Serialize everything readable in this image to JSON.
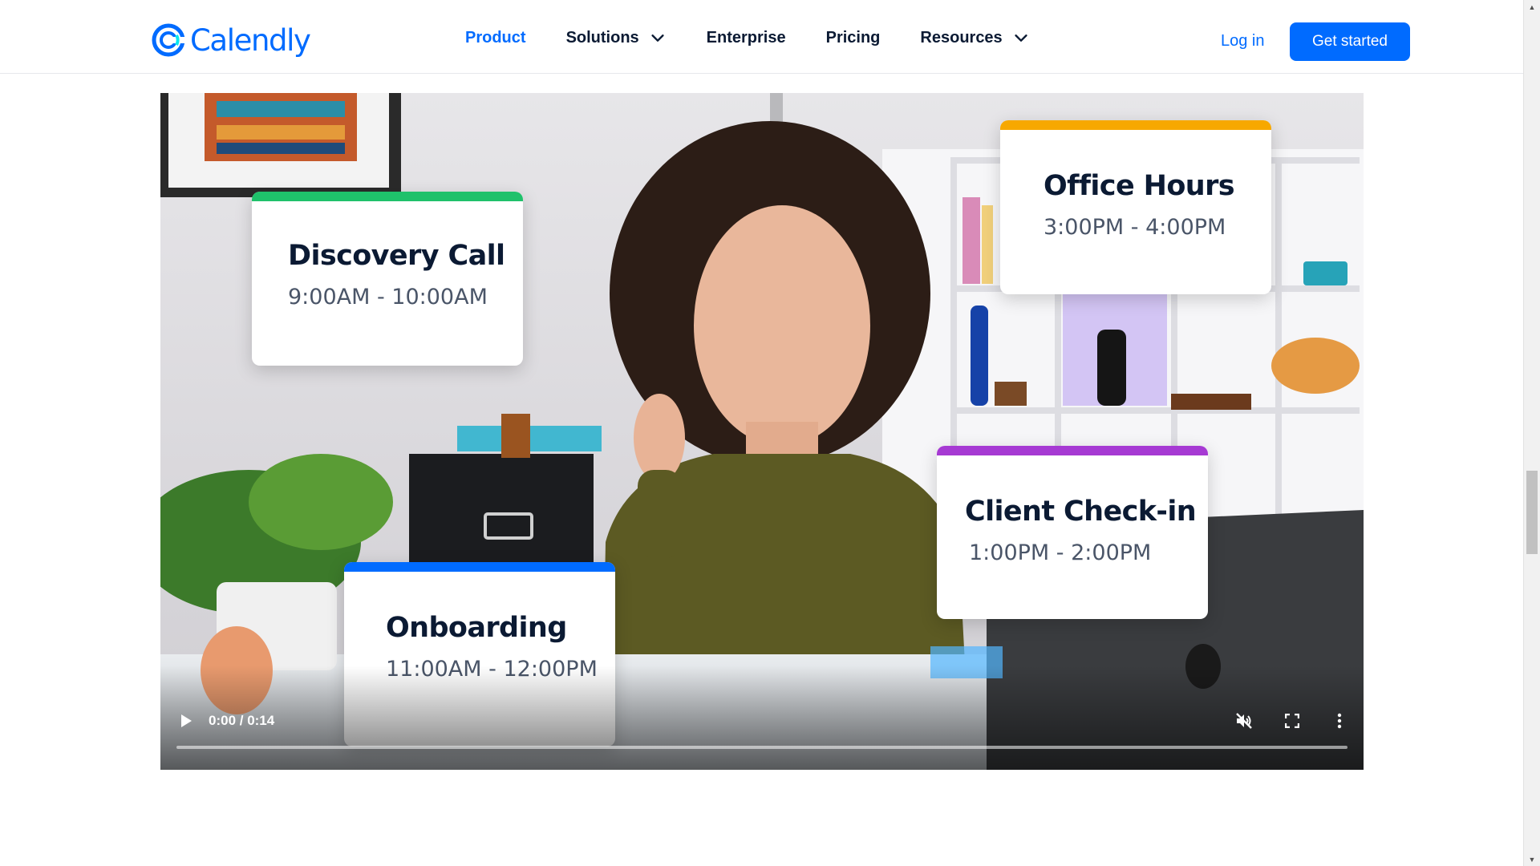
{
  "brand": {
    "name": "Calendly",
    "color": "#006bff"
  },
  "nav": {
    "items": [
      {
        "label": "Product",
        "active": true,
        "dropdown": false
      },
      {
        "label": "Solutions",
        "active": false,
        "dropdown": true
      },
      {
        "label": "Enterprise",
        "active": false,
        "dropdown": false
      },
      {
        "label": "Pricing",
        "active": false,
        "dropdown": false
      },
      {
        "label": "Resources",
        "active": false,
        "dropdown": true
      }
    ],
    "login_label": "Log in",
    "cta_label": "Get started"
  },
  "video": {
    "cards": [
      {
        "title": "Discovery Call",
        "time": "9:00AM - 10:00AM",
        "accent": "#1fc16b"
      },
      {
        "title": "Office Hours",
        "time": "3:00PM - 4:00PM",
        "accent": "#f7a800"
      },
      {
        "title": "Client Check-in",
        "time": "1:00PM - 2:00PM",
        "accent": "#a63ad3"
      },
      {
        "title": "Onboarding",
        "time": "11:00AM - 12:00PM",
        "accent": "#006bff"
      }
    ],
    "controls": {
      "time_display": "0:00 / 0:14",
      "progress": 0,
      "muted": true,
      "icons": [
        "play-icon",
        "muted-speaker-icon",
        "fullscreen-icon",
        "more-vertical-icon"
      ]
    }
  }
}
